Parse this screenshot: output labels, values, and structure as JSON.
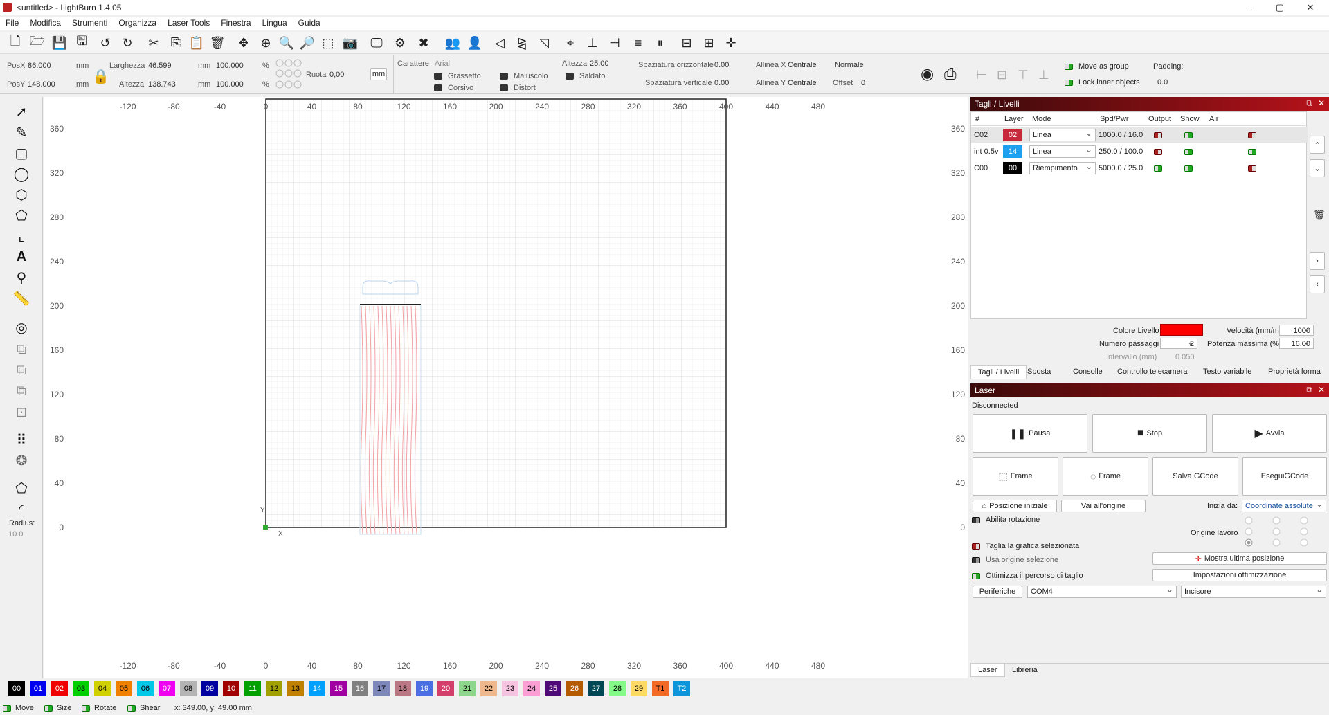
{
  "window": {
    "title": "<untitled> - LightBurn 1.4.05",
    "min": "–",
    "max": "▢",
    "close": "✕"
  },
  "menu": [
    "File",
    "Modifica",
    "Strumenti",
    "Organizza",
    "Laser Tools",
    "Finestra",
    "Lingua",
    "Guida"
  ],
  "props": {
    "posx_label": "PosX",
    "posx": "86.000",
    "posy_label": "PosY",
    "posy": "148.000",
    "unit": "mm",
    "width_label": "Larghezza",
    "width": "46.599",
    "height_label": "Altezza",
    "height": "138.743",
    "pct_w": "100.000",
    "pct_h": "100.000",
    "pct": "%",
    "rotate_label": "Ruota",
    "rotate": "0,00",
    "unit_btn": "mm",
    "font_label": "Carattere",
    "font": "Arial",
    "fheight_label": "Altezza",
    "fheight": "25.00",
    "hspace_label": "Spaziatura orizzontale",
    "hspace": "0.00",
    "vspace_label": "Spaziatura verticale",
    "vspace": "0.00",
    "alignx_label": "Allinea X",
    "alignx": "Centrale",
    "aligny_label": "Allinea Y",
    "aligny": "Centrale",
    "normal": "Normale",
    "offset_label": "Offset",
    "offset": "0",
    "bold": "Grassetto",
    "italic": "Corsivo",
    "upper": "Maiuscolo",
    "distort": "Distort",
    "welded": "Saldato",
    "move_group": "Move as group",
    "lock_inner": "Lock inner objects",
    "padding_label": "Padding:",
    "padding": "0.0"
  },
  "toolbox": {
    "radius_label": "Radius:",
    "radius": "10.0"
  },
  "canvas": {
    "x_ticks": [
      "-120",
      "-80",
      "-40",
      "0",
      "40",
      "80",
      "120",
      "160",
      "200",
      "240",
      "280",
      "320",
      "360",
      "400",
      "440",
      "480"
    ],
    "y_ticks": [
      "360",
      "320",
      "280",
      "240",
      "200",
      "160",
      "120",
      "80",
      "40",
      "0"
    ],
    "x_axis": "X",
    "y_axis": "Y"
  },
  "cuts": {
    "title": "Tagli / Livelli",
    "headers": [
      "#",
      "Layer",
      "Mode",
      "Spd/Pwr",
      "Output",
      "Show",
      "Air"
    ],
    "rows": [
      {
        "name": "C02",
        "layer": "02",
        "color": "#c8283c",
        "mode": "Linea",
        "spd": "1000.0 / 16.0",
        "output": "off",
        "show": "on",
        "air": "off"
      },
      {
        "name": "int 0.5v",
        "layer": "14",
        "color": "#1ea0f0",
        "mode": "Linea",
        "spd": "250.0 / 100.0",
        "output": "off",
        "show": "on",
        "air": "on"
      },
      {
        "name": "C00",
        "layer": "00",
        "color": "#000000",
        "mode": "Riempimento",
        "spd": "5000.0 / 25.0",
        "output": "on",
        "show": "on",
        "air": "off"
      }
    ],
    "layer_color_label": "Colore Livello",
    "speed_label": "Velocità (mm/m)",
    "speed": "1000",
    "passes_label": "Numero passaggi",
    "passes": "2",
    "power_label": "Potenza massima (%)",
    "power": "16,00",
    "interval_label": "Intervallo (mm)",
    "interval": "0.050",
    "tabs": [
      "Tagli / Livelli",
      "Sposta",
      "Consolle",
      "Controllo telecamera",
      "Testo variabile",
      "Proprietà forma"
    ]
  },
  "laser": {
    "title": "Laser",
    "status": "Disconnected",
    "pause": "Pausa",
    "stop": "Stop",
    "start": "Avvia",
    "frame1": "Frame",
    "frame2": "Frame",
    "save_gcode": "Salva GCode",
    "run_gcode": "EseguiGCode",
    "home": "Posizione iniziale",
    "origin": "Vai all'origine",
    "start_from_label": "Inizia da:",
    "start_from": "Coordinate assolute",
    "rotary": "Abilita rotazione",
    "job_origin": "Origine lavoro",
    "cut_selected": "Taglia la grafica selezionata",
    "use_sel_origin": "Usa origine selezione",
    "show_last": "Mostra ultima posizione",
    "optimize": "Ottimizza il percorso di taglio",
    "opt_settings": "Impostazioni ottimizzazione",
    "devices": "Periferiche",
    "port": "COM4",
    "device": "Incisore",
    "tabs": [
      "Laser",
      "Libreria"
    ]
  },
  "palette": [
    {
      "n": "00",
      "c": "#000000",
      "t": "#fff"
    },
    {
      "n": "01",
      "c": "#0000f0",
      "t": "#fff"
    },
    {
      "n": "02",
      "c": "#f00000",
      "t": "#fff"
    },
    {
      "n": "03",
      "c": "#00d000",
      "t": "#000"
    },
    {
      "n": "04",
      "c": "#d0d000",
      "t": "#000"
    },
    {
      "n": "05",
      "c": "#f08000",
      "t": "#000"
    },
    {
      "n": "06",
      "c": "#00c8e6",
      "t": "#000"
    },
    {
      "n": "07",
      "c": "#f000f0",
      "t": "#fff"
    },
    {
      "n": "08",
      "c": "#b4b4b4",
      "t": "#000"
    },
    {
      "n": "09",
      "c": "#0000a0",
      "t": "#fff"
    },
    {
      "n": "10",
      "c": "#a00000",
      "t": "#fff"
    },
    {
      "n": "11",
      "c": "#00a000",
      "t": "#fff"
    },
    {
      "n": "12",
      "c": "#a0a000",
      "t": "#000"
    },
    {
      "n": "13",
      "c": "#c08000",
      "t": "#000"
    },
    {
      "n": "14",
      "c": "#00a0ff",
      "t": "#fff"
    },
    {
      "n": "15",
      "c": "#a000a0",
      "t": "#fff"
    },
    {
      "n": "16",
      "c": "#808080",
      "t": "#fff"
    },
    {
      "n": "17",
      "c": "#7d87b9",
      "t": "#000"
    },
    {
      "n": "18",
      "c": "#bb7784",
      "t": "#000"
    },
    {
      "n": "19",
      "c": "#4a6fe3",
      "t": "#fff"
    },
    {
      "n": "20",
      "c": "#d33f6a",
      "t": "#fff"
    },
    {
      "n": "21",
      "c": "#8cd78c",
      "t": "#000"
    },
    {
      "n": "22",
      "c": "#f0b98d",
      "t": "#000"
    },
    {
      "n": "23",
      "c": "#f6c4e1",
      "t": "#000"
    },
    {
      "n": "24",
      "c": "#fa9ed4",
      "t": "#000"
    },
    {
      "n": "25",
      "c": "#500a78",
      "t": "#fff"
    },
    {
      "n": "26",
      "c": "#b45a00",
      "t": "#fff"
    },
    {
      "n": "27",
      "c": "#004754",
      "t": "#fff"
    },
    {
      "n": "28",
      "c": "#86fa88",
      "t": "#000"
    },
    {
      "n": "29",
      "c": "#ffdb66",
      "t": "#000"
    },
    {
      "n": "T1",
      "c": "#f36926",
      "t": "#000"
    },
    {
      "n": "T2",
      "c": "#0c96d9",
      "t": "#fff"
    }
  ],
  "status": {
    "move": "Move",
    "size": "Size",
    "rotate": "Rotate",
    "shear": "Shear",
    "coords": "x: 349.00, y: 49.00 mm"
  }
}
